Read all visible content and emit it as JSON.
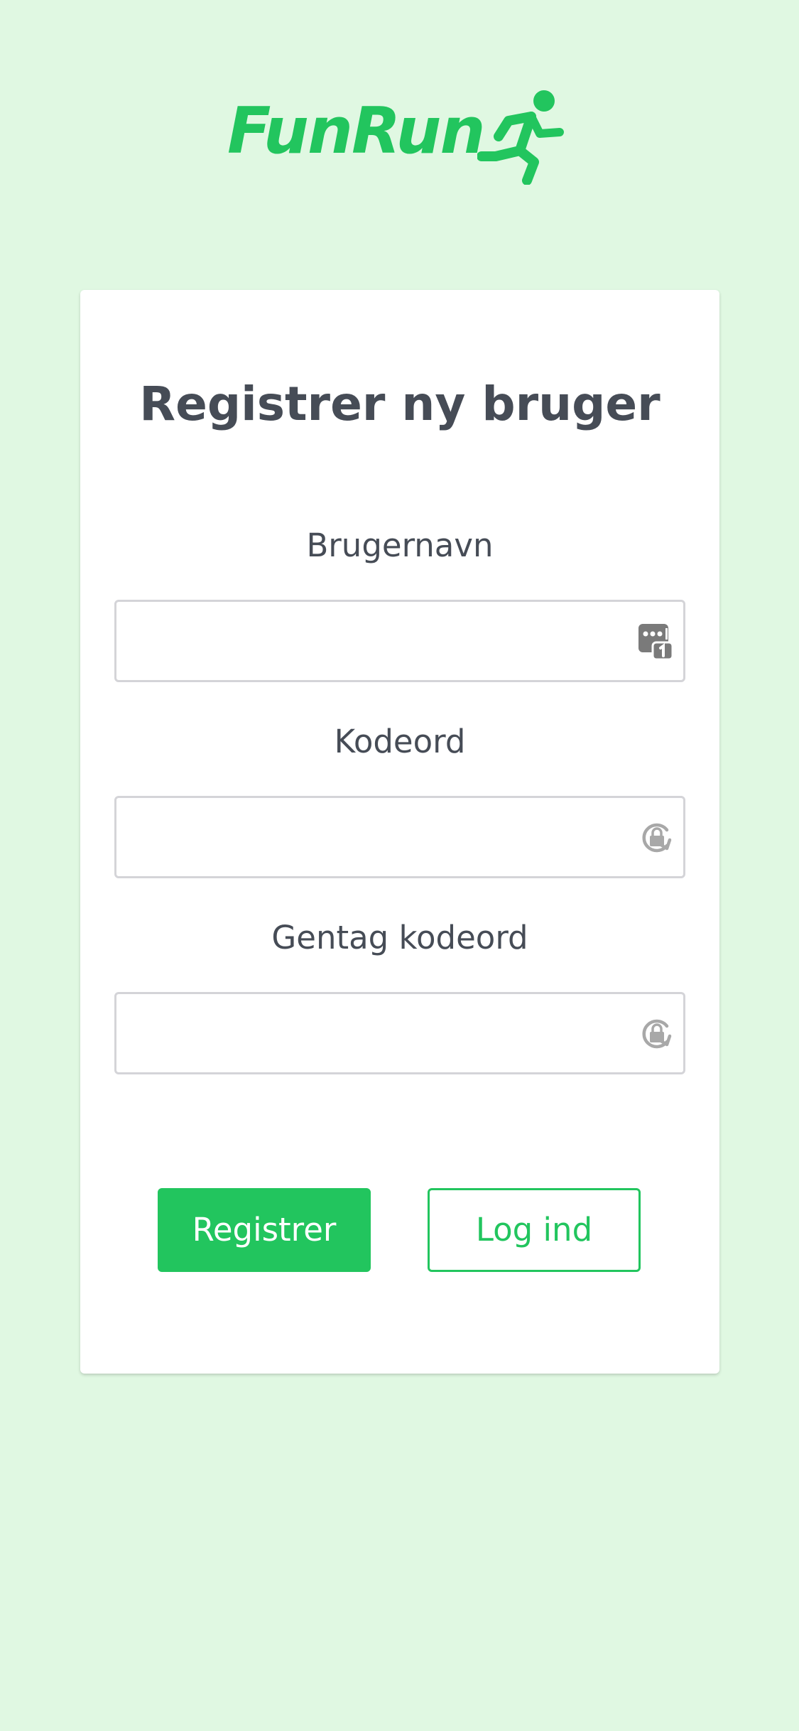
{
  "brand": {
    "name": "FunRun",
    "color": "#22c55e"
  },
  "form": {
    "title": "Registrer ny bruger",
    "fields": [
      {
        "label": "Brugernavn",
        "value": "",
        "icon": "credential-autofill-icon"
      },
      {
        "label": "Kodeord",
        "value": "",
        "icon": "password-lock-icon"
      },
      {
        "label": "Gentag kodeord",
        "value": "",
        "icon": "password-lock-icon"
      }
    ],
    "register_label": "Registrer",
    "login_label": "Log ind"
  },
  "colors": {
    "background": "#e0f8e2",
    "text": "#464c56",
    "accent": "#22c55e"
  }
}
